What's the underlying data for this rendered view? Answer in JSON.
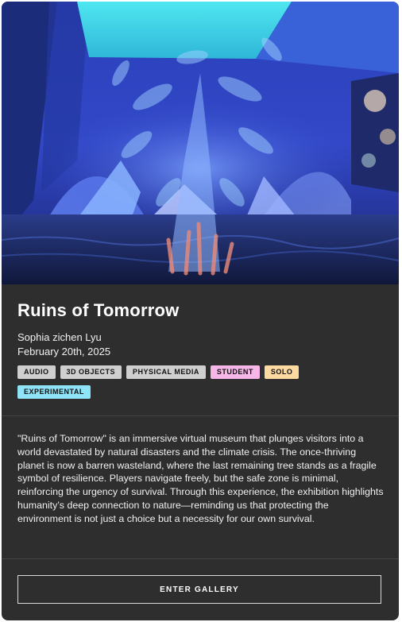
{
  "artwork": {
    "title": "Ruins of Tomorrow",
    "artist": "Sophia zichen Lyu",
    "date": "February 20th, 2025"
  },
  "tags": [
    {
      "label": "AUDIO",
      "color": "#cfcfcf"
    },
    {
      "label": "3D OBJECTS",
      "color": "#cfcfcf"
    },
    {
      "label": "PHYSICAL MEDIA",
      "color": "#cfcfcf"
    },
    {
      "label": "STUDENT",
      "color": "#f6b6e8"
    },
    {
      "label": "SOLO",
      "color": "#fcd9a0"
    },
    {
      "label": "EXPERIMENTAL",
      "color": "#8ee3f7"
    }
  ],
  "description": "\"Ruins of Tomorrow\" is an immersive virtual museum that plunges visitors into a world devastated by natural disasters and the climate crisis. The once-thriving planet is now a barren wasteland, where the last remaining tree stands as a fragile symbol of resilience. Players navigate freely, but the safe zone is minimal, reinforcing the urgency of survival. Through this experience, the exhibition highlights humanity’s deep connection to nature—reminding us that protecting the environment is not just a choice but a necessity for our own survival.",
  "actions": {
    "enter_label": "ENTER GALLERY"
  },
  "colors": {
    "card_background": "#2e2e2e",
    "divider": "#444444",
    "text": "#f0f0f0"
  }
}
